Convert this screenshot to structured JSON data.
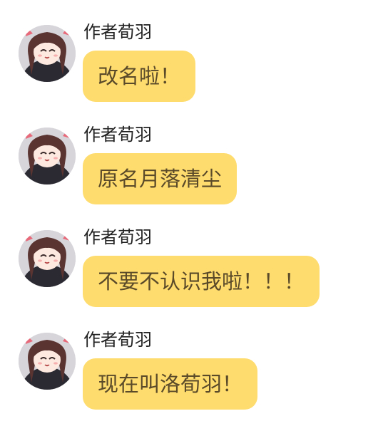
{
  "messages": [
    {
      "sender": "作者荀羽",
      "text": "改名啦！"
    },
    {
      "sender": "作者荀羽",
      "text": "原名月落清尘"
    },
    {
      "sender": "作者荀羽",
      "text": "不要不认识我啦！！！"
    },
    {
      "sender": "作者荀羽",
      "text": "现在叫洛荀羽！"
    }
  ],
  "colors": {
    "bubble": "#fedc6d",
    "bubble_text": "#5a4a2a",
    "sender_text": "#222222",
    "background": "#ffffff"
  },
  "icons": {
    "avatar": "anime-girl-avatar-icon"
  }
}
